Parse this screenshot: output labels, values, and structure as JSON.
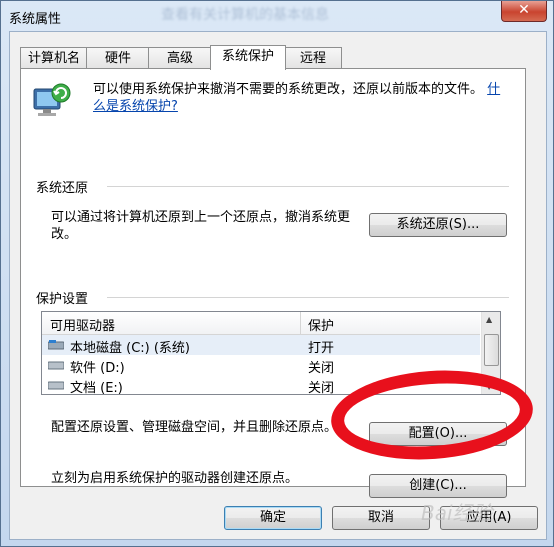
{
  "window": {
    "title": "系统属性",
    "ghost_title": "查看有关计算机的基本信息",
    "close_glyph": "✕"
  },
  "tabs": [
    {
      "label": "计算机名"
    },
    {
      "label": "硬件"
    },
    {
      "label": "高级"
    },
    {
      "label": "系统保护",
      "active": true
    },
    {
      "label": "远程"
    }
  ],
  "intro": {
    "text": "可以使用系统保护来撤消不需要的系统更改，还原以前版本的文件。",
    "link": "什么是系统保护?"
  },
  "restore_group": {
    "title": "系统还原",
    "description": "可以通过将计算机还原到上一个还原点，撤消系统更改。",
    "button": "系统还原(S)..."
  },
  "protection_group": {
    "title": "保护设置",
    "columns": [
      "可用驱动器",
      "保护"
    ],
    "drives": [
      {
        "name": "本地磁盘 (C:) (系统)",
        "protection": "打开",
        "icon": "system-drive-icon",
        "selected": true
      },
      {
        "name": "软件 (D:)",
        "protection": "关闭",
        "icon": "drive-icon"
      },
      {
        "name": "文档 (E:)",
        "protection": "关闭",
        "icon": "drive-icon"
      }
    ],
    "configure_text": "配置还原设置、管理磁盘空间，并且删除还原点。",
    "configure_button": "配置(O)...",
    "create_text": "立刻为启用系统保护的驱动器创建还原点。",
    "create_button": "创建(C)..."
  },
  "footer": {
    "ok": "确定",
    "cancel": "取消",
    "apply": "应用(A)"
  },
  "annotation": {
    "color": "#e8101c",
    "shape": "hand-drawn-red-oval"
  },
  "watermark": {
    "text": "Bai经验"
  }
}
